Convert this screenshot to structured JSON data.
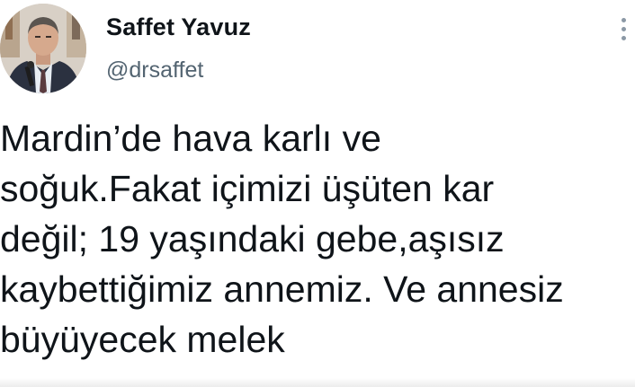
{
  "tweet": {
    "author": {
      "display_name": "Saffet Yavuz",
      "handle": "@drsaffet",
      "avatar_icon": "profile-photo"
    },
    "menu_icon": "more-dots-icon",
    "text_lines": [
      "Mardin’de hava karlı ve",
      "soğuk.Fakat içimizi üşüten kar",
      "değil; 19 yaşındaki gebe,aşısız",
      "kaybettiğimiz annemiz. Ve annesiz",
      "büyüyecek melek"
    ]
  },
  "colors": {
    "text_primary": "#0f1419",
    "text_secondary": "#536471",
    "icon": "#8b98a5",
    "background": "#ffffff"
  }
}
